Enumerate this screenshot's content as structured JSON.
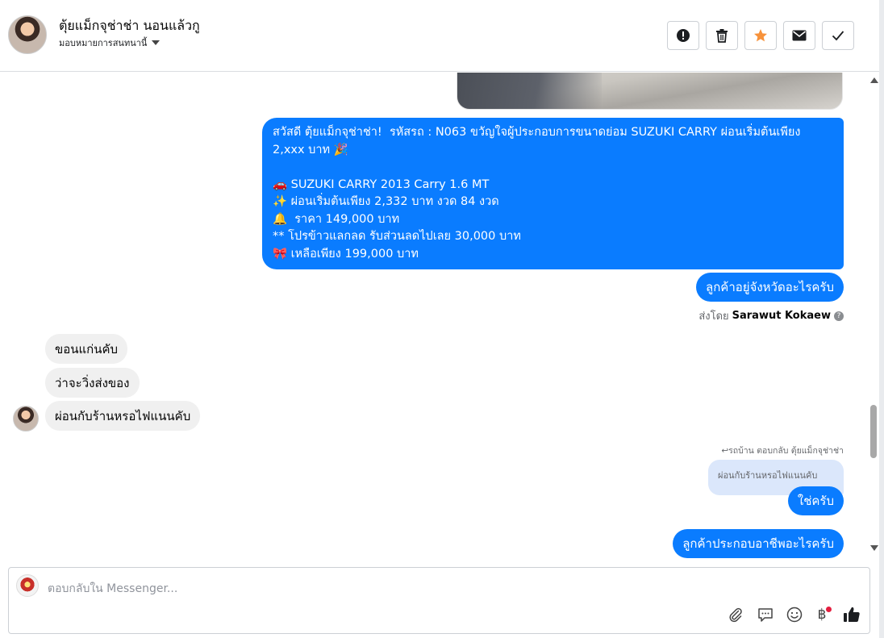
{
  "header": {
    "contact_name": "ตุ้ยแม็กจุช่าช่า นอนแล้วกู",
    "assign_label": "มอบหมายการสนทนานี้"
  },
  "thread": {
    "main_message": "สวัสดี ตุ้ยแม็กจุช่าช่า!  รหัสรถ : N063 ขวัญใจผู้ประกอบการขนาดย่อม SUZUKI CARRY ผ่อนเริ่มต้นเพียง 2,xxx บาท 🎉\n\n🚗 SUZUKI CARRY 2013 Carry 1.6 MT\n✨ ผ่อนเริ่มต้นเพียง 2,332 บาท งวด 84 งวด\n🔔  ราคา 149,000 บาท\n** โปรข้าวแลกลด รับส่วนลดไปเลย 30,000 บาท\n🎀 เหลือเพียง 199,000 บาท",
    "out_question_province": "ลูกค้าอยู่จังหวัดอะไรครับ",
    "sent_by_prefix": "ส่งโดย",
    "sent_by_name": "Sarawut Kokaew",
    "in_messages": [
      "ขอนแก่นคับ",
      "ว่าจะวิ่งส่งของ",
      "ผ่อนกับร้านหรอไฟแนนคับ"
    ],
    "reply_meta": "↩รถบ้าน ตอบกลับ ตุ้ยแม็กจุช่าช่า",
    "quoted_text": "ผ่อนกับร้านหรอไฟแนนคับ",
    "out_yes": "ใช่ครับ",
    "out_question_job": "ลูกค้าประกอบอาชีพอะไรครับ"
  },
  "composer": {
    "placeholder": "ตอบกลับใน Messenger..."
  },
  "icons": [
    "alert-icon",
    "trash-icon",
    "star-icon",
    "envelope-icon",
    "check-icon",
    "paperclip-icon",
    "saved-replies-icon",
    "emoji-icon",
    "baht-icon",
    "thumbs-up-icon"
  ],
  "colors": {
    "outgoing_bubble": "#0a7cff",
    "incoming_bubble": "#f0f0f0",
    "star": "#f7923b"
  }
}
